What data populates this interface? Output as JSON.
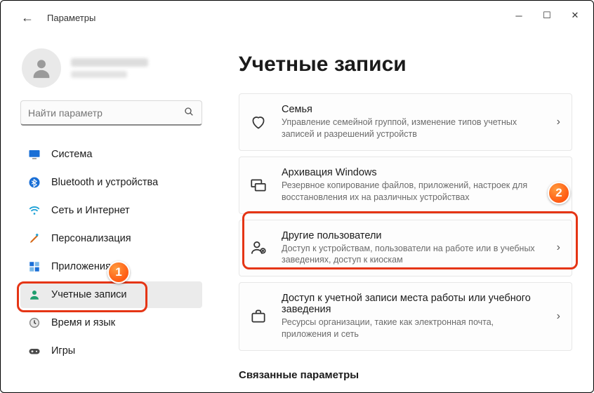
{
  "app_title": "Параметры",
  "search": {
    "placeholder": "Найти параметр"
  },
  "sidebar": {
    "items": [
      {
        "label": "Система"
      },
      {
        "label": "Bluetooth и устройства"
      },
      {
        "label": "Сеть и Интернет"
      },
      {
        "label": "Персонализация"
      },
      {
        "label": "Приложения"
      },
      {
        "label": "Учетные записи"
      },
      {
        "label": "Время и язык"
      },
      {
        "label": "Игры"
      }
    ]
  },
  "main": {
    "heading": "Учетные записи",
    "cards": [
      {
        "title": "Семья",
        "desc": "Управление семейной группой, изменение типов учетных записей и разрешений устройств"
      },
      {
        "title": "Архивация Windows",
        "desc": "Резервное копирование файлов, приложений, настроек для восстановления их на различных устройствах"
      },
      {
        "title": "Другие пользователи",
        "desc": "Доступ к устройствам, пользователи на работе или в учебных заведениях, доступ к киоскам"
      },
      {
        "title": "Доступ к учетной записи места работы или учебного заведения",
        "desc": "Ресурсы организации, такие как электронная почта, приложения и сеть"
      }
    ],
    "related_heading": "Связанные параметры"
  },
  "annotations": {
    "badge1": "1",
    "badge2": "2"
  }
}
